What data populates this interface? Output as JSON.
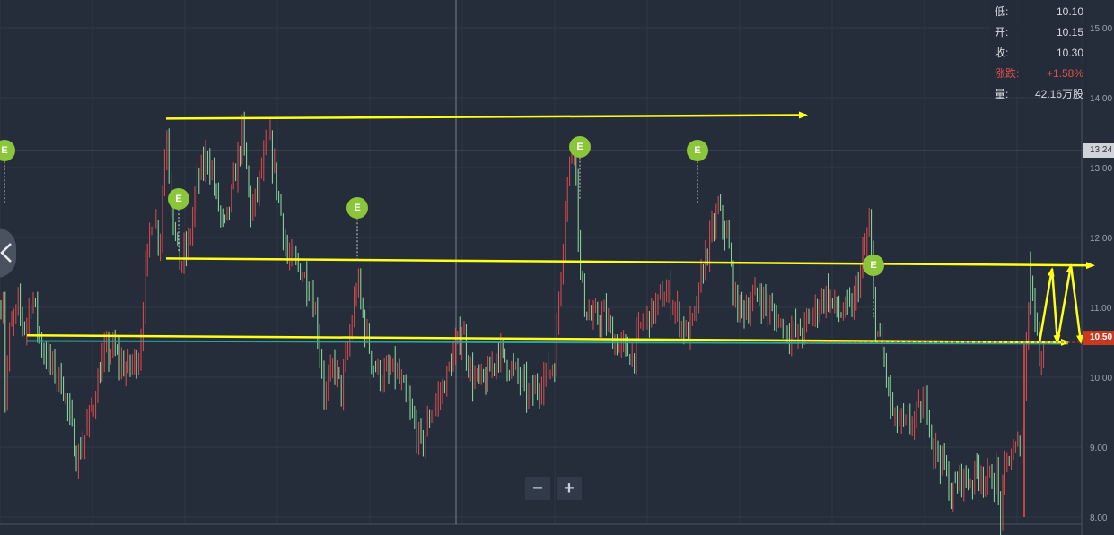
{
  "info_panel": {
    "low_label": "低:",
    "low_value": "10.10",
    "open_label": "开:",
    "open_value": "10.15",
    "close_label": "收:",
    "close_value": "10.30",
    "change_label": "涨跌:",
    "change_value": "+1.58%",
    "volume_label": "量:",
    "volume_value": "42.16万股"
  },
  "crosshair_price": "13.24",
  "current_price_label": "10.50",
  "zoom": {
    "minus": "−",
    "plus": "+"
  },
  "marker_label": "E",
  "colors": {
    "up": "#e14c4c",
    "down": "#8ee0a2",
    "trend": "#ffff1a",
    "teal": "#2aa59b"
  },
  "chart_data": {
    "type": "candlestick",
    "ylim": [
      8.0,
      15.3
    ],
    "y_ticks": [
      "8.00",
      "9.00",
      "10.00",
      "11.00",
      "12.00",
      "13.00",
      "14.00",
      "15.00"
    ],
    "price_path": [
      [
        0,
        10.9
      ],
      [
        3,
        11.4
      ],
      [
        6,
        9.6
      ],
      [
        10,
        10.6
      ],
      [
        20,
        11.0
      ],
      [
        28,
        10.7
      ],
      [
        36,
        11.2
      ],
      [
        45,
        10.5
      ],
      [
        55,
        10.2
      ],
      [
        70,
        9.9
      ],
      [
        82,
        9.1
      ],
      [
        86,
        8.8
      ],
      [
        95,
        9.2
      ],
      [
        105,
        9.7
      ],
      [
        115,
        10.3
      ],
      [
        125,
        10.4
      ],
      [
        140,
        10.1
      ],
      [
        155,
        10.3
      ],
      [
        162,
        11.5
      ],
      [
        170,
        12.4
      ],
      [
        178,
        11.9
      ],
      [
        185,
        13.6
      ],
      [
        192,
        12.3
      ],
      [
        200,
        11.6
      ],
      [
        210,
        11.9
      ],
      [
        220,
        12.8
      ],
      [
        232,
        13.2
      ],
      [
        242,
        12.5
      ],
      [
        250,
        12.1
      ],
      [
        258,
        12.6
      ],
      [
        270,
        13.5
      ],
      [
        280,
        12.3
      ],
      [
        292,
        13.0
      ],
      [
        300,
        13.4
      ],
      [
        310,
        12.6
      ],
      [
        320,
        11.7
      ],
      [
        332,
        11.6
      ],
      [
        345,
        11.3
      ],
      [
        352,
        10.9
      ],
      [
        362,
        9.7
      ],
      [
        372,
        10.2
      ],
      [
        380,
        9.8
      ],
      [
        390,
        10.6
      ],
      [
        398,
        11.4
      ],
      [
        405,
        10.8
      ],
      [
        415,
        10.2
      ],
      [
        425,
        10.0
      ],
      [
        440,
        10.1
      ],
      [
        452,
        9.7
      ],
      [
        462,
        9.3
      ],
      [
        470,
        9.0
      ],
      [
        480,
        9.5
      ],
      [
        492,
        9.8
      ],
      [
        505,
        10.3
      ],
      [
        515,
        10.7
      ],
      [
        525,
        10.0
      ],
      [
        540,
        9.9
      ],
      [
        555,
        10.4
      ],
      [
        565,
        10.2
      ],
      [
        578,
        10.0
      ],
      [
        590,
        9.7
      ],
      [
        605,
        10.0
      ],
      [
        618,
        10.2
      ],
      [
        625,
        11.6
      ],
      [
        632,
        12.8
      ],
      [
        640,
        13.5
      ],
      [
        646,
        11.5
      ],
      [
        652,
        11.0
      ],
      [
        660,
        10.8
      ],
      [
        672,
        10.9
      ],
      [
        685,
        10.5
      ],
      [
        695,
        10.4
      ],
      [
        705,
        10.3
      ],
      [
        715,
        10.8
      ],
      [
        725,
        10.9
      ],
      [
        735,
        11.1
      ],
      [
        745,
        11.2
      ],
      [
        755,
        10.9
      ],
      [
        765,
        10.6
      ],
      [
        775,
        10.9
      ],
      [
        785,
        11.7
      ],
      [
        792,
        12.0
      ],
      [
        800,
        12.4
      ],
      [
        810,
        12.0
      ],
      [
        820,
        11.0
      ],
      [
        832,
        11.0
      ],
      [
        845,
        11.2
      ],
      [
        860,
        10.9
      ],
      [
        875,
        10.7
      ],
      [
        890,
        10.6
      ],
      [
        905,
        10.9
      ],
      [
        920,
        11.2
      ],
      [
        935,
        10.9
      ],
      [
        950,
        11.0
      ],
      [
        960,
        11.6
      ],
      [
        968,
        12.2
      ],
      [
        975,
        10.8
      ],
      [
        985,
        10.2
      ],
      [
        995,
        9.4
      ],
      [
        1010,
        9.3
      ],
      [
        1025,
        9.5
      ],
      [
        1032,
        9.7
      ],
      [
        1040,
        9.0
      ],
      [
        1050,
        8.8
      ],
      [
        1060,
        8.3
      ],
      [
        1070,
        8.6
      ],
      [
        1080,
        8.5
      ],
      [
        1090,
        8.7
      ],
      [
        1100,
        8.5
      ],
      [
        1110,
        8.6
      ],
      [
        1115,
        7.9
      ],
      [
        1120,
        8.8
      ],
      [
        1130,
        8.9
      ],
      [
        1140,
        9.2
      ],
      [
        1143,
        10.5
      ],
      [
        1147,
        11.5
      ],
      [
        1152,
        11.0
      ],
      [
        1158,
        10.3
      ],
      [
        1163,
        10.5
      ]
    ],
    "trend_lines": [
      {
        "from": [
          185,
          13.7
        ],
        "to": [
          898,
          13.75
        ],
        "arrow": true
      },
      {
        "from": [
          185,
          11.7
        ],
        "to": [
          1218,
          11.6
        ],
        "arrow": true
      },
      {
        "from": [
          30,
          10.6
        ],
        "to": [
          1190,
          10.5
        ],
        "arrow": true
      }
    ],
    "zigzag": [
      [
        1158,
        10.5
      ],
      [
        1172,
        11.55
      ],
      [
        1178,
        10.5
      ],
      [
        1193,
        11.6
      ],
      [
        1204,
        10.5
      ]
    ],
    "teal_line": {
      "from": [
        30,
        10.52
      ],
      "to": [
        1190,
        10.48
      ]
    },
    "markers": [
      [
        5,
        13.24
      ],
      [
        199,
        12.55
      ],
      [
        398,
        12.42
      ],
      [
        646,
        13.3
      ],
      [
        777,
        13.24
      ],
      [
        973,
        11.6
      ]
    ],
    "crosshair": {
      "x": 508,
      "y": 13.24
    }
  }
}
